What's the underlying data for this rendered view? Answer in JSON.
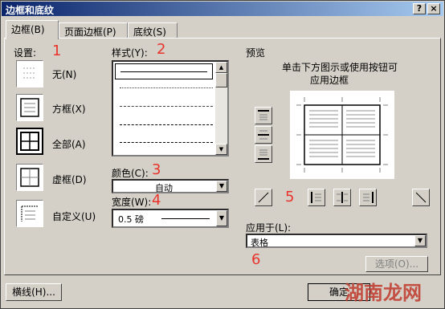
{
  "window": {
    "title": "边框和底纹",
    "help_label": "?",
    "close_label": "×"
  },
  "tabs": [
    {
      "label": "边框(B)"
    },
    {
      "label": "页面边框(P)"
    },
    {
      "label": "底纹(S)"
    }
  ],
  "settings": {
    "label": "设置:",
    "items": [
      {
        "label": "无(N)"
      },
      {
        "label": "方框(X)"
      },
      {
        "label": "全部(A)"
      },
      {
        "label": "虚框(D)"
      },
      {
        "label": "自定义(U)"
      }
    ]
  },
  "style": {
    "label": "样式(Y):"
  },
  "color": {
    "label": "颜色(C):",
    "value": "自动"
  },
  "width": {
    "label": "宽度(W):",
    "value": "0.5 磅"
  },
  "preview": {
    "label": "预览",
    "hint_line1": "单击下方图示或使用按钮可",
    "hint_line2": "应用边框"
  },
  "apply": {
    "label": "应用于(L):",
    "value": "表格"
  },
  "buttons": {
    "options": "选项(O)...",
    "horizontal_line": "横线(H)...",
    "ok": "确定"
  },
  "annotations": [
    "1",
    "2",
    "3",
    "4",
    "5",
    "6"
  ],
  "watermark": "湖南龙网"
}
